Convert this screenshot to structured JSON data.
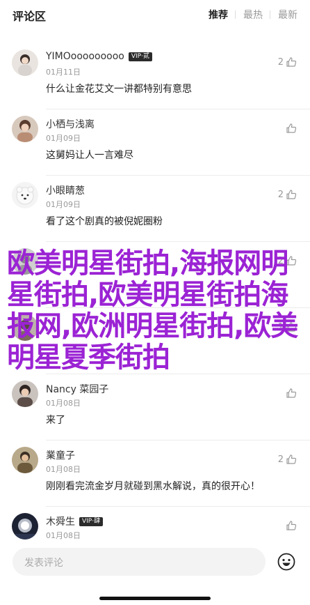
{
  "header": {
    "title": "评论区",
    "tabs": [
      {
        "label": "推荐",
        "active": true
      },
      {
        "label": "最热",
        "active": false
      },
      {
        "label": "最新",
        "active": false
      }
    ]
  },
  "comments": [
    {
      "user": "YIMOooooooooo",
      "badge": "VIP·贰",
      "date": "01月11日",
      "text": "什么让金花艾文一讲都特别有意思",
      "likes": "2",
      "avatar": "girl-portrait-avatar"
    },
    {
      "user": "小栖与浅离",
      "badge": "",
      "date": "01月09日",
      "text": "这舅妈让人一言难尽",
      "likes": "",
      "avatar": "woman-portrait-avatar"
    },
    {
      "user": "小眼睛葱",
      "badge": "",
      "date": "01月09日",
      "text": "看了这个剧真的被倪妮圈粉",
      "likes": "2",
      "avatar": "polar-bear-avatar"
    },
    {
      "user": "",
      "badge": "",
      "date": "",
      "text": "",
      "likes": "2",
      "avatar": "obscured-avatar"
    },
    {
      "user": "",
      "badge": "",
      "date": "",
      "text": "",
      "likes": "1",
      "avatar": "obscured-avatar"
    },
    {
      "user": "Nancy 菜园子",
      "badge": "",
      "date": "01月08日",
      "text": "来了",
      "likes": "",
      "avatar": "woman-portrait-avatar"
    },
    {
      "user": "業童子",
      "badge": "",
      "date": "01月08日",
      "text": "刚刚看完流金岁月就碰到黑水解说，真的很开心！",
      "likes": "2",
      "avatar": "man-portrait-avatar"
    },
    {
      "user": "木舜生",
      "badge": "VIP·肆",
      "date": "01月08日",
      "text": "",
      "likes": "",
      "avatar": "night-scene-avatar"
    }
  ],
  "watermark": "欧美明星街拍,海报网明星街拍,欧美明星街拍海报网,欧洲明星街拍,欧美明星夏季街拍",
  "footer": {
    "placeholder": "发表评论",
    "emoji_icon": "smiley-face-icon"
  },
  "colors": {
    "watermark": "#9b23d4",
    "muted": "#999999",
    "text": "#222222"
  }
}
